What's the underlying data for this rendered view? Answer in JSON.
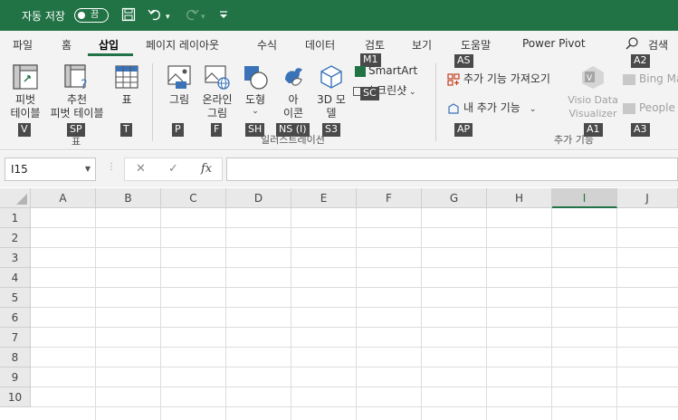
{
  "titlebar": {
    "autosave_label": "자동 저장",
    "autosave_state": "끔",
    "qat_icons": [
      "save-icon",
      "undo-icon",
      "redo-icon",
      "customize-icon"
    ]
  },
  "tabs": [
    {
      "label": "파일",
      "active": false
    },
    {
      "label": "홈",
      "active": false
    },
    {
      "label": "삽입",
      "active": true
    },
    {
      "label": "페이지 레이아웃",
      "active": false
    },
    {
      "label": "수식",
      "active": false
    },
    {
      "label": "데이터",
      "active": false
    },
    {
      "label": "검토",
      "active": false
    },
    {
      "label": "보기",
      "active": false
    },
    {
      "label": "도움말",
      "active": false
    },
    {
      "label": "Power Pivot",
      "active": false
    }
  ],
  "search_label": "검색",
  "ribbon": {
    "pivot": {
      "line1": "피벗",
      "line2": "테이블",
      "keytip": "V"
    },
    "recommended_pivot": {
      "line1": "추천",
      "line2": "피벗 테이블",
      "keytip": "SP"
    },
    "table": {
      "label": "표",
      "keytip": "T"
    },
    "group_table_label": "표",
    "picture": {
      "label": "그림",
      "keytip": "P"
    },
    "online_picture": {
      "line1": "온라인",
      "line2": "그림",
      "keytip": "F"
    },
    "shapes": {
      "label": "도형",
      "keytip": "SH"
    },
    "icons": {
      "line1": "아",
      "line2": "이콘",
      "keytip": "NS (I)"
    },
    "model3d": {
      "line1": "3D 모",
      "line2": "델",
      "keytip": "S3"
    },
    "smartart": {
      "label": "SmartArt",
      "keytip": "M1"
    },
    "screenshot": {
      "label": "스크린샷",
      "keytip": "SC"
    },
    "group_illustrations_label": "일러스트레이션",
    "get_addins": {
      "label": "추가 기능 가져오기",
      "keytip": "AS"
    },
    "my_addins": {
      "label": "내 추가 기능",
      "keytip": "AP"
    },
    "visio": {
      "line1": "Visio Data",
      "line2": "Visualizer",
      "keytip": "A1"
    },
    "bing": {
      "label": "Bing Ma",
      "keytip": "A2"
    },
    "people": {
      "label": "People G",
      "keytip": "A3"
    },
    "group_addins_label": "추가 기능"
  },
  "formula_bar": {
    "name_box": "I15",
    "cancel_symbol": "✕",
    "enter_symbol": "✓",
    "fx_symbol": "fx",
    "formula_value": ""
  },
  "sheet": {
    "columns": [
      "A",
      "B",
      "C",
      "D",
      "E",
      "F",
      "G",
      "H",
      "I",
      "J"
    ],
    "rows": [
      "1",
      "2",
      "3",
      "4",
      "5",
      "6",
      "7",
      "8",
      "9",
      "10"
    ],
    "selected_column": "I",
    "accent_color": "#217346"
  }
}
